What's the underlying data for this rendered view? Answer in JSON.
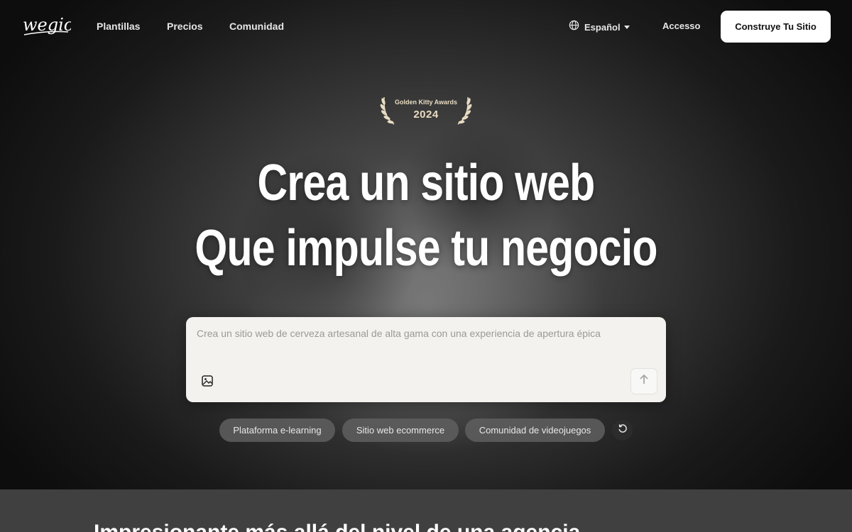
{
  "nav": {
    "logo_text": "wegic",
    "links": [
      "Plantillas",
      "Precios",
      "Comunidad"
    ],
    "language": "Español",
    "login": "Accesso",
    "cta": "Construye Tu Sitio"
  },
  "badge": {
    "title": "Golden Kitty Awards",
    "year": "2024"
  },
  "hero": {
    "line1": "Crea un sitio web",
    "line2": "Que impulse tu negocio"
  },
  "prompt": {
    "placeholder": "Crea un sitio web de cerveza artesanal de alta gama con una experiencia de apertura épica"
  },
  "suggestions": [
    "Plataforma e-learning",
    "Sitio web ecommerce",
    "Comunidad de videojuegos"
  ],
  "next_section": {
    "title": "Impresionante más allá del nivel de una agencia"
  },
  "colors": {
    "cta_bg": "#ffffff",
    "prompt_bg": "#f3f2ef",
    "badge_gold": "#e8dcc2",
    "chip_bg": "#5f5f5f"
  },
  "icons": [
    "globe-icon",
    "caret-down-icon",
    "laurel-left-icon",
    "laurel-right-icon",
    "image-upload-icon",
    "arrow-up-icon",
    "refresh-icon"
  ]
}
